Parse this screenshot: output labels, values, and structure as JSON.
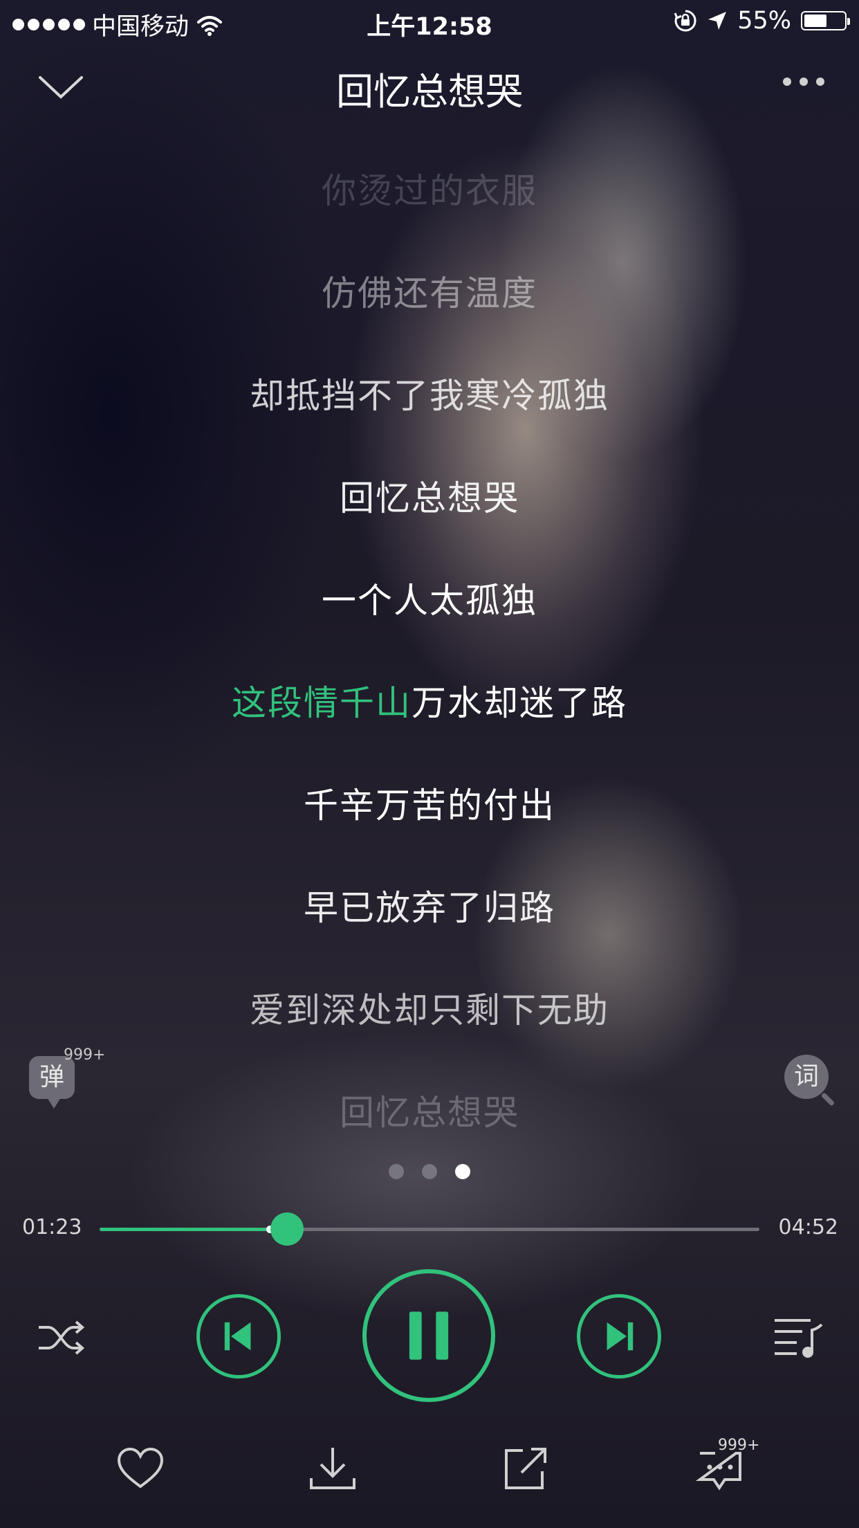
{
  "status_bar": {
    "carrier": "中国移动",
    "time": "上午12:58",
    "battery_text": "55%",
    "battery_level": 0.55
  },
  "header": {
    "title": "回忆总想哭"
  },
  "lyrics": {
    "lines": [
      "你烫过的衣服",
      "仿佛还有温度",
      "却抵挡不了我寒冷孤独",
      "回忆总想哭",
      "一个人太孤独",
      "这段情千山万水却迷了路",
      "千辛万苦的付出",
      "早已放弃了归路",
      "爱到深处却只剩下无助",
      "回忆总想哭"
    ],
    "current_line_sung": "这段情千山",
    "current_line_rest": "万水却迷了路",
    "highlight_color": "#31c27c"
  },
  "danmaku": {
    "label": "弹",
    "count": "999+"
  },
  "lyric_button": {
    "label": "词"
  },
  "pager": {
    "count": 3,
    "active_index": 2
  },
  "progress": {
    "elapsed": "01:23",
    "total": "04:52",
    "fraction": 0.284
  },
  "controls": {
    "shuffle_icon": "shuffle-icon",
    "prev_icon": "skip-previous-icon",
    "play_state": "pause-icon",
    "next_icon": "skip-next-icon",
    "playlist_icon": "playlist-icon",
    "accent_color": "#31c27c"
  },
  "bottom_bar": {
    "favorite_icon": "heart-icon",
    "download_icon": "download-icon",
    "share_icon": "share-icon",
    "comment_icon": "comment-icon",
    "comment_count": "999+"
  }
}
